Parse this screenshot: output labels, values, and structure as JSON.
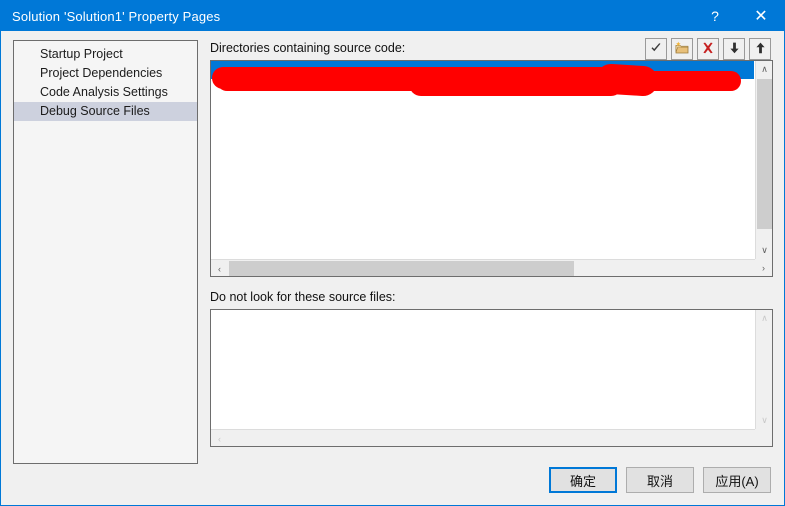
{
  "window": {
    "title": "Solution 'Solution1' Property Pages",
    "help_button": "?",
    "close_button": "✕",
    "accent_color": "#0078d7",
    "titlebar_text_color": "#ffffff",
    "dialog_background": "#f0f0f0"
  },
  "sidebar": {
    "items": [
      {
        "label": "Startup Project",
        "selected": false
      },
      {
        "label": "Project Dependencies",
        "selected": false
      },
      {
        "label": "Code Analysis Settings",
        "selected": false
      },
      {
        "label": "Debug Source Files",
        "selected": true
      }
    ],
    "selection_color": "#cdd1de"
  },
  "directories_section": {
    "label": "Directories containing source code:",
    "toolbar": [
      {
        "name": "check-icon",
        "tooltip": "Check Entries"
      },
      {
        "name": "new-folder-icon",
        "tooltip": "New Line"
      },
      {
        "name": "delete-icon",
        "tooltip": "Cut"
      },
      {
        "name": "move-down-icon",
        "tooltip": "Move Down"
      },
      {
        "name": "move-up-icon",
        "tooltip": "Move Up"
      }
    ],
    "items": [
      {
        "text": "",
        "selected": true,
        "redacted": true
      }
    ],
    "selected_row_color": "#0078d7",
    "redaction_color": "#ff0000",
    "scrollbars": {
      "vertical_enabled": true,
      "horizontal_enabled": true,
      "horizontal_thumb_fraction": 0.66,
      "vertical_thumb_fraction": 0.8
    }
  },
  "exclude_section": {
    "label": "Do not look for these source files:",
    "items": [],
    "scrollbars": {
      "vertical_enabled": false,
      "horizontal_enabled": false
    }
  },
  "buttons": {
    "ok": "确定",
    "cancel": "取消",
    "apply": "应用(A)"
  },
  "scroll_glyphs": {
    "up": "∧",
    "down": "∨",
    "left": "‹",
    "right": "›"
  }
}
